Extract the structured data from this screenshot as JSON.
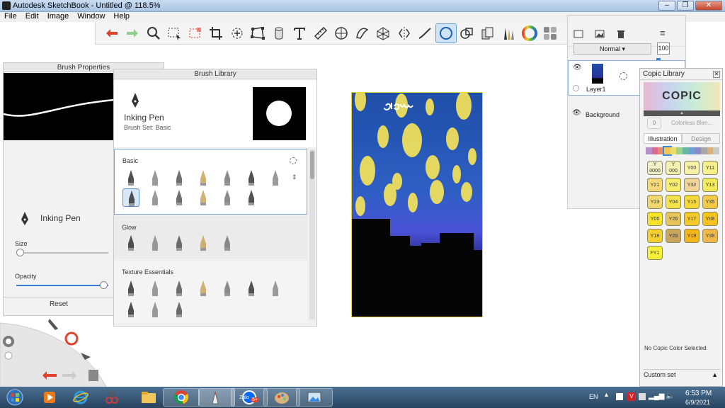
{
  "window": {
    "title": "Autodesk SketchBook - Untitled @ 118.5%",
    "controls": [
      "–",
      "❐",
      "✕"
    ]
  },
  "menu": [
    "File",
    "Edit",
    "Image",
    "Window",
    "Help"
  ],
  "toolbar": {
    "tools": [
      {
        "name": "undo",
        "icon": "undo-arrow-icon",
        "color": "#e0432b"
      },
      {
        "name": "redo",
        "icon": "redo-arrow-icon",
        "color": "#7cc27a"
      },
      {
        "name": "zoom",
        "icon": "magnifier-icon"
      },
      {
        "name": "select",
        "icon": "marquee-select-icon"
      },
      {
        "name": "select-red",
        "icon": "lasso-marquee-icon"
      },
      {
        "name": "crop",
        "icon": "crop-icon"
      },
      {
        "name": "transform",
        "icon": "move-rotate-icon"
      },
      {
        "name": "distort",
        "icon": "distort-icon"
      },
      {
        "name": "fill",
        "icon": "bucket-icon"
      },
      {
        "name": "text",
        "icon": "text-icon"
      },
      {
        "name": "ruler",
        "icon": "ruler-icon"
      },
      {
        "name": "ellipse",
        "icon": "ellipse-guide-icon"
      },
      {
        "name": "french-curve",
        "icon": "french-curve-icon"
      },
      {
        "name": "perspective",
        "icon": "perspective-icon"
      },
      {
        "name": "symmetry",
        "icon": "symmetry-icon"
      },
      {
        "name": "stroke",
        "icon": "stroke-icon"
      },
      {
        "name": "shape",
        "icon": "circle-shape-icon",
        "active": true
      },
      {
        "name": "shapes",
        "icon": "shapes-icon"
      },
      {
        "name": "copy",
        "icon": "copy-icon"
      },
      {
        "name": "brushes",
        "icon": "brushes-icon"
      },
      {
        "name": "color",
        "icon": "color-wheel-icon"
      },
      {
        "name": "copic-palette",
        "icon": "copic-palette-icon"
      }
    ]
  },
  "brush_properties": {
    "title": "Brush Properties",
    "brush_name": "Inking Pen",
    "size_label": "Size",
    "opacity_label": "Opacity",
    "size_value": 0.02,
    "opacity_value": 1.0,
    "reset_label": "Reset"
  },
  "brush_library": {
    "title": "Brush Library",
    "selected_name": "Inking Pen",
    "brush_set": "Brush Set: Basic",
    "sections": [
      {
        "label": "Basic"
      },
      {
        "label": "Glow"
      },
      {
        "label": "Texture Essentials"
      }
    ]
  },
  "layers": {
    "blend_mode": "Normal",
    "opacity": "100",
    "items": [
      {
        "name": "Layer1",
        "selected": true
      },
      {
        "name": "Background",
        "selected": false
      }
    ]
  },
  "copic": {
    "title": "Copic Library",
    "logo": "COPIC",
    "colorless": "Colorless Blen...",
    "colorless_code": "0",
    "tabs": [
      "Illustration",
      "Design"
    ],
    "active_tab": "Illustration",
    "swatches": [
      {
        "code": "Y\n0000",
        "color": "#f2f0c8"
      },
      {
        "code": "Y\n000",
        "color": "#f4f0b0"
      },
      {
        "code": "Y00",
        "color": "#f6f1a6"
      },
      {
        "code": "Y11",
        "color": "#f5ef8c"
      },
      {
        "code": "Y21",
        "color": "#f5d878"
      },
      {
        "code": "Y02",
        "color": "#f6ee6a"
      },
      {
        "code": "Y32",
        "color": "#f2d39a"
      },
      {
        "code": "Y13",
        "color": "#f2ea5a"
      },
      {
        "code": "Y23",
        "color": "#f2d66e"
      },
      {
        "code": "Y04",
        "color": "#f5e14a"
      },
      {
        "code": "Y15",
        "color": "#f7d63a"
      },
      {
        "code": "Y35",
        "color": "#f4c94a"
      },
      {
        "code": "Y06",
        "color": "#f7e42a"
      },
      {
        "code": "Y26",
        "color": "#e6c45a"
      },
      {
        "code": "Y17",
        "color": "#f4c92a"
      },
      {
        "code": "Y08",
        "color": "#f6c41a"
      },
      {
        "code": "Y18",
        "color": "#f3d030"
      },
      {
        "code": "Y28",
        "color": "#c9a45a"
      },
      {
        "code": "Y19",
        "color": "#f2b51a"
      },
      {
        "code": "Y38",
        "color": "#f0b84a"
      },
      {
        "code": "FY1",
        "color": "#f6f03a"
      }
    ],
    "no_selection": "No Copic Color Selected",
    "custom_set": "Custom set"
  },
  "canvas": {
    "handwriting": "elam"
  },
  "taskbar": {
    "apps": [
      "start-orb-icon",
      "media-player-icon",
      "internet-explorer-icon",
      "paint-snip-icon",
      "file-explorer-icon",
      "chrome-icon",
      "sketchbook-icon",
      "zalo-icon",
      "paint-icon",
      "photo-viewer-icon"
    ],
    "zalo_label": "Zalo",
    "zalo_badge": "5+",
    "lang": "EN",
    "time": "6:53 PM",
    "date": "6/9/2021"
  }
}
